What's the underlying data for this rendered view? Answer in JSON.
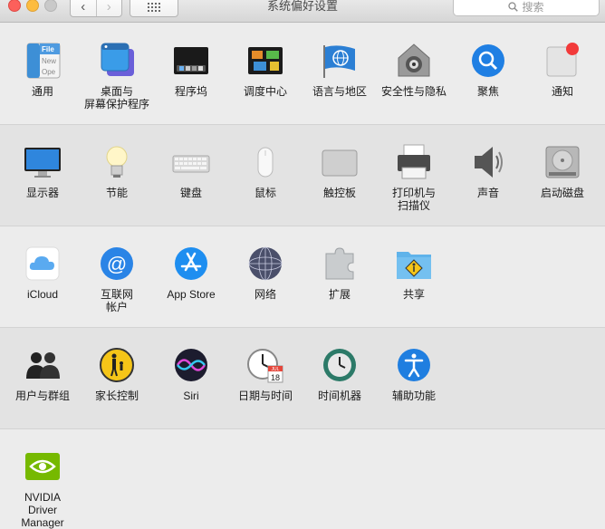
{
  "window": {
    "title": "系统偏好设置"
  },
  "toolbar": {
    "back_glyph": "‹",
    "forward_glyph": "›",
    "search_placeholder": "搜索"
  },
  "sections": [
    {
      "items": [
        {
          "label": "通用",
          "icon": "general-icon"
        },
        {
          "label": "桌面与\n屏幕保护程序",
          "icon": "desktop-screensaver-icon"
        },
        {
          "label": "程序坞",
          "icon": "dock-icon"
        },
        {
          "label": "调度中心",
          "icon": "mission-control-icon"
        },
        {
          "label": "语言与地区",
          "icon": "language-region-icon"
        },
        {
          "label": "安全性与隐私",
          "icon": "security-privacy-icon"
        },
        {
          "label": "聚焦",
          "icon": "spotlight-icon"
        },
        {
          "label": "通知",
          "icon": "notifications-icon"
        }
      ]
    },
    {
      "items": [
        {
          "label": "显示器",
          "icon": "displays-icon"
        },
        {
          "label": "节能",
          "icon": "energy-saver-icon"
        },
        {
          "label": "键盘",
          "icon": "keyboard-icon"
        },
        {
          "label": "鼠标",
          "icon": "mouse-icon"
        },
        {
          "label": "触控板",
          "icon": "trackpad-icon"
        },
        {
          "label": "打印机与\n扫描仪",
          "icon": "printer-scanner-icon"
        },
        {
          "label": "声音",
          "icon": "sound-icon"
        },
        {
          "label": "启动磁盘",
          "icon": "startup-disk-icon"
        }
      ]
    },
    {
      "items": [
        {
          "label": "iCloud",
          "icon": "icloud-icon"
        },
        {
          "label": "互联网\n帐户",
          "icon": "internet-accounts-icon"
        },
        {
          "label": "App Store",
          "icon": "app-store-icon"
        },
        {
          "label": "网络",
          "icon": "network-icon"
        },
        {
          "label": "扩展",
          "icon": "extensions-icon"
        },
        {
          "label": "共享",
          "icon": "sharing-icon"
        }
      ]
    },
    {
      "items": [
        {
          "label": "用户与群组",
          "icon": "users-groups-icon"
        },
        {
          "label": "家长控制",
          "icon": "parental-controls-icon"
        },
        {
          "label": "Siri",
          "icon": "siri-icon"
        },
        {
          "label": "日期与时间",
          "icon": "date-time-icon"
        },
        {
          "label": "时间机器",
          "icon": "time-machine-icon"
        },
        {
          "label": "辅助功能",
          "icon": "accessibility-icon"
        }
      ]
    },
    {
      "items": [
        {
          "label": "NVIDIA\nDriver Manager",
          "icon": "nvidia-icon"
        }
      ]
    }
  ],
  "icon_text": {
    "general_file": "File",
    "general_new": "New",
    "general_open": "Ope",
    "calendar_month": "JUL",
    "calendar_day": "18"
  }
}
